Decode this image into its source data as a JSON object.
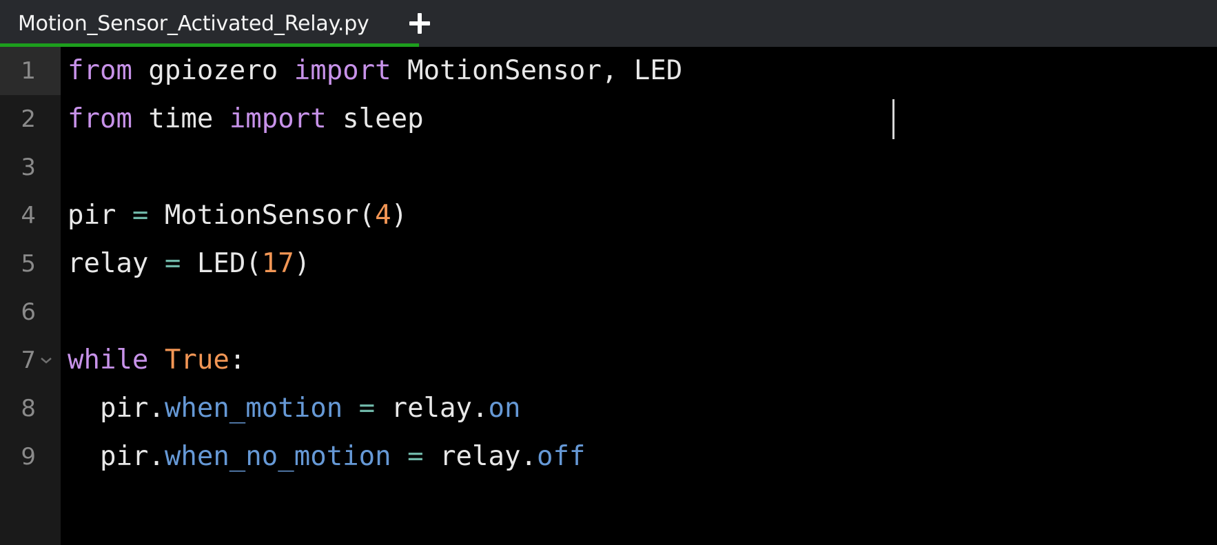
{
  "window": {
    "app": "code-editor",
    "background": "#000000"
  },
  "tabbar": {
    "background": "#282a2e",
    "active_indicator_color": "#1d9e1d",
    "tabs": [
      {
        "label": "Motion_Sensor_Activated_Relay.py",
        "active": true
      }
    ],
    "new_tab": {
      "icon": "plus-icon",
      "label": "+"
    }
  },
  "editor": {
    "language": "python",
    "gutter_background": "#1a1a1a",
    "current_line": 1,
    "caret": {
      "line": 1,
      "column": 33
    },
    "theme": {
      "background": "#000000",
      "text": "#e8e8e8",
      "keyword": "#c792e9",
      "number": "#f29655",
      "boolean": "#f29655",
      "operator": "#6fb7a8",
      "attribute": "#6699d6",
      "line_number": "#8a8a8a"
    },
    "lines": [
      {
        "number": "1",
        "fold": false,
        "current": true,
        "text": "from gpiozero import MotionSensor, LED",
        "tokens": [
          {
            "t": "from",
            "c": "t-kw"
          },
          {
            "t": " gpiozero ",
            "c": "t-id"
          },
          {
            "t": "import",
            "c": "t-kw"
          },
          {
            "t": " MotionSensor, LED",
            "c": "t-id"
          }
        ]
      },
      {
        "number": "2",
        "fold": false,
        "current": false,
        "text": "from time import sleep",
        "tokens": [
          {
            "t": "from",
            "c": "t-kw"
          },
          {
            "t": " time ",
            "c": "t-id"
          },
          {
            "t": "import",
            "c": "t-kw"
          },
          {
            "t": " sleep",
            "c": "t-id"
          }
        ]
      },
      {
        "number": "3",
        "fold": false,
        "current": false,
        "text": "",
        "tokens": []
      },
      {
        "number": "4",
        "fold": false,
        "current": false,
        "text": "pir = MotionSensor(4)",
        "tokens": [
          {
            "t": "pir ",
            "c": "t-id"
          },
          {
            "t": "=",
            "c": "t-op"
          },
          {
            "t": " MotionSensor(",
            "c": "t-id"
          },
          {
            "t": "4",
            "c": "t-num"
          },
          {
            "t": ")",
            "c": "t-punc"
          }
        ]
      },
      {
        "number": "5",
        "fold": false,
        "current": false,
        "text": "relay = LED(17)",
        "tokens": [
          {
            "t": "relay ",
            "c": "t-id"
          },
          {
            "t": "=",
            "c": "t-op"
          },
          {
            "t": " LED(",
            "c": "t-id"
          },
          {
            "t": "17",
            "c": "t-num"
          },
          {
            "t": ")",
            "c": "t-punc"
          }
        ]
      },
      {
        "number": "6",
        "fold": false,
        "current": false,
        "text": "",
        "tokens": []
      },
      {
        "number": "7",
        "fold": true,
        "current": false,
        "text": "while True:",
        "tokens": [
          {
            "t": "while ",
            "c": "t-kw"
          },
          {
            "t": "True",
            "c": "t-bool"
          },
          {
            "t": ":",
            "c": "t-punc"
          }
        ]
      },
      {
        "number": "8",
        "fold": false,
        "current": false,
        "text": "  pir.when_motion = relay.on",
        "tokens": [
          {
            "t": "  pir.",
            "c": "t-id"
          },
          {
            "t": "when_motion",
            "c": "t-attr"
          },
          {
            "t": " ",
            "c": "t-id"
          },
          {
            "t": "=",
            "c": "t-op"
          },
          {
            "t": " relay.",
            "c": "t-id"
          },
          {
            "t": "on",
            "c": "t-attr"
          }
        ]
      },
      {
        "number": "9",
        "fold": false,
        "current": false,
        "text": "  pir.when_no_motion = relay.off",
        "tokens": [
          {
            "t": "  pir.",
            "c": "t-id"
          },
          {
            "t": "when_no_motion",
            "c": "t-attr"
          },
          {
            "t": " ",
            "c": "t-id"
          },
          {
            "t": "=",
            "c": "t-op"
          },
          {
            "t": " relay.",
            "c": "t-id"
          },
          {
            "t": "off",
            "c": "t-attr"
          }
        ]
      }
    ]
  }
}
